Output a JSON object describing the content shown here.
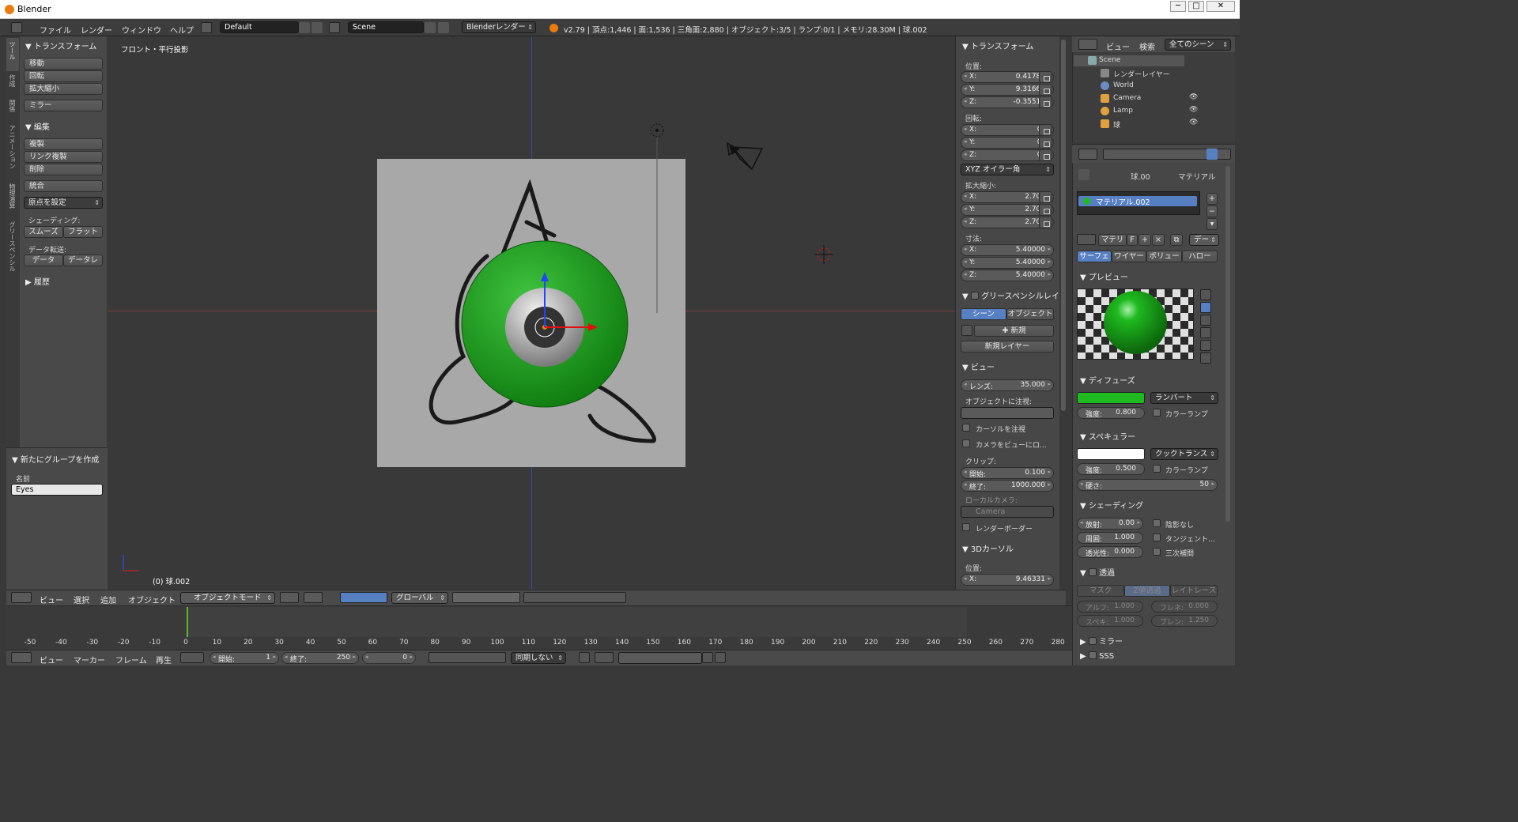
{
  "window": {
    "title": "Blender"
  },
  "infobar": {
    "menus": [
      "ファイル",
      "レンダー",
      "ウィンドウ",
      "ヘルプ"
    ],
    "layout": "Default",
    "scene": "Scene",
    "engine": "Blenderレンダー",
    "stats": "v2.79 | 頂点:1,446 | 面:1,536 | 三角面:2,880 | オブジェクト:3/5 | ランプ:0/1 | メモリ:28.30M | 球.002"
  },
  "left_tabs": [
    "ツール",
    "作成",
    "関係",
    "アニメーション",
    "物理演算",
    "グリースペンシル"
  ],
  "toolshelf": {
    "transform_header": "トランスフォーム",
    "transform_buttons": [
      "移動",
      "回転",
      "拡大縮小"
    ],
    "mirror": "ミラー",
    "edit_header": "編集",
    "edit_buttons": [
      "複製",
      "リンク複製",
      "削除"
    ],
    "join": "統合",
    "origin": "原点を設定",
    "shading_label": "シェーディング:",
    "smooth": "スムーズ",
    "flat": "フラット",
    "data_transfer_label": "データ転送:",
    "data1": "データ",
    "data2": "データレ",
    "history_header": "履歴",
    "group_header": "新たにグループを作成",
    "name_label": "名前",
    "name_value": "Eyes"
  },
  "viewport": {
    "view_label": "フロント・平行投影",
    "object_label": "(0) 球.002"
  },
  "view3d_header": {
    "menus": [
      "ビュー",
      "選択",
      "追加",
      "オブジェクト"
    ],
    "mode": "オブジェクトモード",
    "orientation": "グローバル"
  },
  "npanel": {
    "transform_header": "トランスフォーム",
    "location_label": "位置:",
    "location": [
      {
        "k": "X:",
        "v": "0.41781"
      },
      {
        "k": "Y:",
        "v": "9.31664"
      },
      {
        "k": "Z:",
        "v": "-0.35513"
      }
    ],
    "rotation_label": "回転:",
    "rotation": [
      {
        "k": "X:",
        "v": "0°"
      },
      {
        "k": "Y:",
        "v": "0°"
      },
      {
        "k": "Z:",
        "v": "0°"
      }
    ],
    "rotation_mode": "XYZ オイラー角",
    "scale_label": "拡大縮小:",
    "scale": [
      {
        "k": "X:",
        "v": "2.700"
      },
      {
        "k": "Y:",
        "v": "2.700"
      },
      {
        "k": "Z:",
        "v": "2.700"
      }
    ],
    "dimensions_label": "寸法:",
    "dimensions": [
      {
        "k": "X:",
        "v": "5.40000"
      },
      {
        "k": "Y:",
        "v": "5.40000"
      },
      {
        "k": "Z:",
        "v": "5.40000"
      }
    ],
    "gp_header": "グリースペンシルレイ",
    "gp_scene": "シーン",
    "gp_object": "オブジェクト",
    "gp_new": "新規",
    "gp_new_layer": "新規レイヤー",
    "view_header": "ビュー",
    "lens_k": "レンズ:",
    "lens_v": "35.000",
    "lock_object_label": "オブジェクトに注視:",
    "lock_cursor": "カーソルを注視",
    "camera_to_view": "カメラをビューにロ...",
    "clip_label": "クリップ:",
    "clip_start_k": "開始:",
    "clip_start_v": "0.100",
    "clip_end_k": "終了:",
    "clip_end_v": "1000.000",
    "local_camera_label": "ローカルカメラ:",
    "local_camera": "Camera",
    "render_border": "レンダーボーダー",
    "cursor_header": "3Dカーソル",
    "cursor_location_label": "位置:",
    "cursor_x_k": "X:",
    "cursor_x_v": "9.46331"
  },
  "outliner": {
    "view": "ビュー",
    "search": "検索",
    "filter": "全てのシーン",
    "items": [
      "Scene",
      "レンダーレイヤー",
      "World",
      "Camera",
      "Lamp",
      "球"
    ]
  },
  "properties": {
    "breadcrumb_obj": "球.00",
    "breadcrumb_mat": "マテリアル",
    "material_slot": "マテリアル.002",
    "mat_name": "マテリ",
    "mat_f": "F",
    "data_btn": "デー",
    "tabs": [
      "サーフェ",
      "ワイヤー",
      "ボリュー",
      "ハロー"
    ],
    "preview_header": "プレビュー",
    "diffuse_header": "ディフューズ",
    "diffuse_color": "#1fba1f",
    "diffuse_shader": "ランバート",
    "diffuse_intensity_k": "強度:",
    "diffuse_intensity_v": "0.800",
    "ramp": "カラーランプ",
    "specular_header": "スペキュラー",
    "specular_color": "#ffffff",
    "specular_shader": "クックトランス",
    "spec_intensity_k": "強度:",
    "spec_intensity_v": "0.500",
    "hardness_k": "硬さ:",
    "hardness_v": "50",
    "shading_header": "シェーディング",
    "emit_k": "放射:",
    "emit_v": "0.00",
    "ambient_k": "周囲:",
    "ambient_v": "1.000",
    "translucency_k": "透光性:",
    "translucency_v": "0.000",
    "shadeless": "陰影なし",
    "tangent": "タンジェント...",
    "cubic": "三次補間",
    "transparency_header": "透過",
    "trans_tabs": [
      "マスク",
      "Z値透過",
      "レイトレース"
    ],
    "alpha_k": "アルフ:",
    "alpha_v": "1.000",
    "fresnel_k": "フレネ:",
    "fresnel_v": "0.000",
    "specular_k": "スペキ:",
    "specular_v": "1.000",
    "blend_k": "ブレン:",
    "blend_v": "1.250",
    "mirror_header": "ミラー",
    "sss_header": "SSS"
  },
  "timeline": {
    "ticks": [
      "-50",
      "-40",
      "-30",
      "-20",
      "-10",
      "0",
      "10",
      "20",
      "30",
      "40",
      "50",
      "60",
      "70",
      "80",
      "90",
      "100",
      "110",
      "120",
      "130",
      "140",
      "150",
      "160",
      "170",
      "180",
      "190",
      "200",
      "210",
      "220",
      "230",
      "240",
      "250",
      "260",
      "270",
      "280"
    ],
    "menus": [
      "ビュー",
      "マーカー",
      "フレーム",
      "再生"
    ],
    "start_k": "開始:",
    "start_v": "1",
    "end_k": "終了:",
    "end_v": "250",
    "current": "0",
    "sync": "同期しない"
  }
}
